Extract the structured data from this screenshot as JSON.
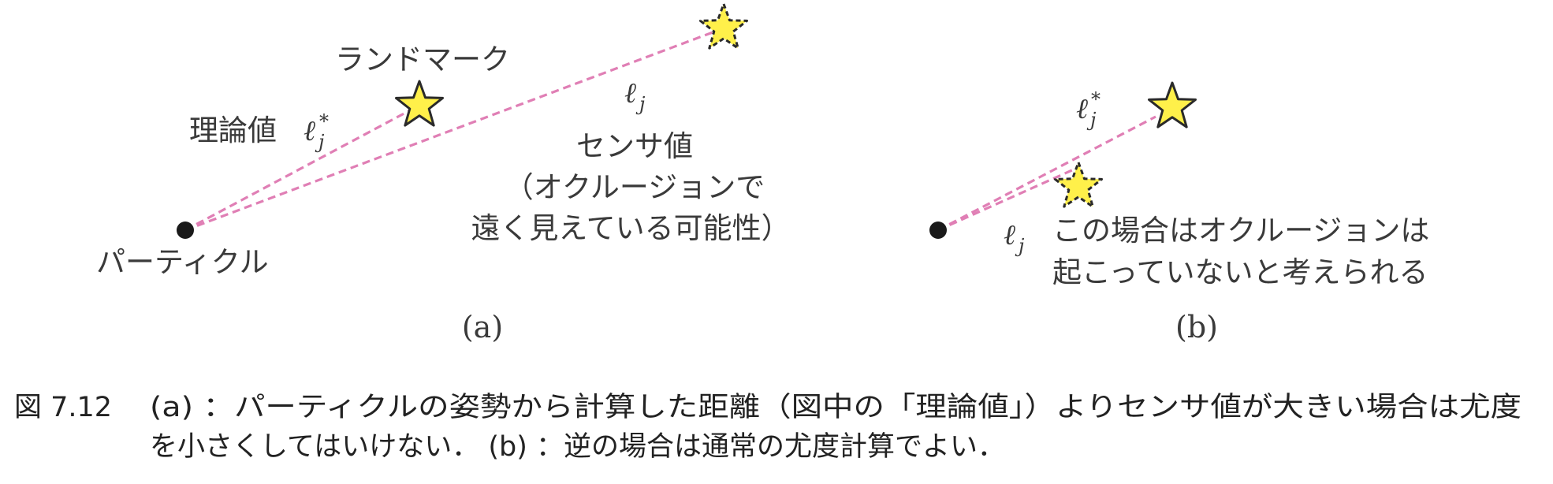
{
  "panel_a": {
    "landmark_label": "ランドマーク",
    "theory_label": "理論値",
    "theory_symbol": "ℓ",
    "theory_sub": "j",
    "theory_sup": "*",
    "sensor_symbol": "ℓ",
    "sensor_sub": "j",
    "sensor_lines": [
      "センサ値",
      "（オクルージョンで",
      "遠く見えている可能性）"
    ],
    "particle_label": "パーティクル",
    "panel_label": "(a)"
  },
  "panel_b": {
    "theory_symbol": "ℓ",
    "theory_sub": "j",
    "theory_sup": "*",
    "sensor_symbol": "ℓ",
    "sensor_sub": "j",
    "note_lines": [
      "この場合はオクルージョンは",
      "起こっていないと考えられる"
    ],
    "panel_label": "(b)"
  },
  "caption": {
    "number": "図 7.12",
    "line1": "(a) ：パーティクルの姿勢から計算した距離（図中の「理論値」）よりセンサ値が大きい場合は尤度",
    "line2": "を小さくしてはいけない．   (b) ：逆の場合は通常の尤度計算でよい．"
  },
  "colors": {
    "ray": "#e07fb5",
    "star_fill": "#fff04a",
    "star_stroke": "#2a2a2a",
    "particle": "#1a1a1a"
  }
}
